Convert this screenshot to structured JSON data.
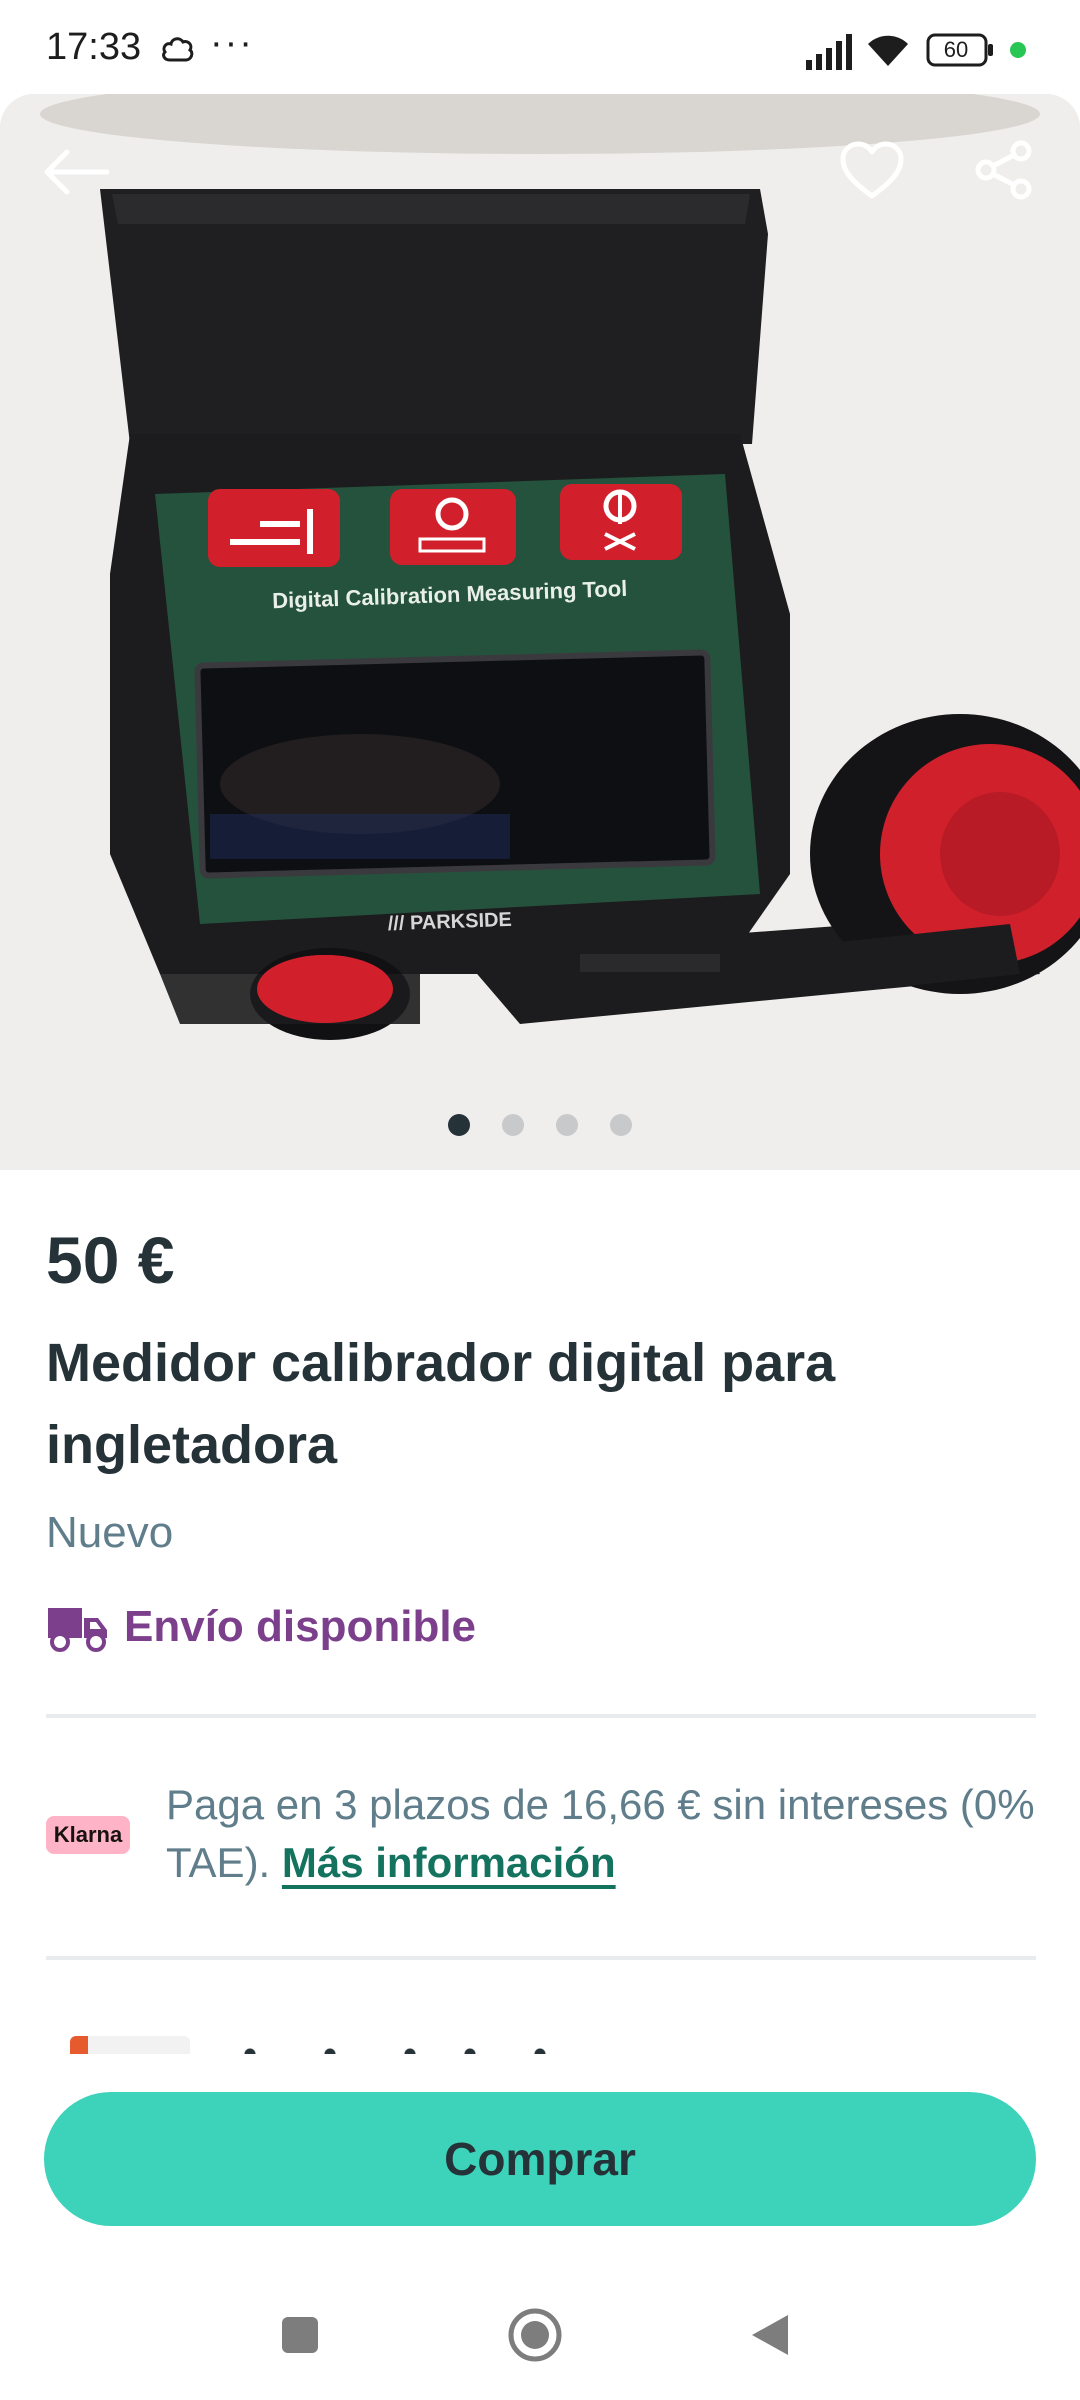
{
  "status_bar": {
    "time": "17:33",
    "more": "···",
    "battery": "60"
  },
  "hero": {
    "product_label": "Digital Calibration Measuring Tool",
    "brand_label": "/// PARKSIDE",
    "image_count": 4,
    "active_image": 1
  },
  "listing": {
    "price": "50 €",
    "title": "Medidor calibrador digital para ingletadora",
    "condition": "Nuevo",
    "shipping": "Envío disponible"
  },
  "klarna": {
    "badge": "Klarna",
    "text": "Paga en 3 plazos de 16,66 € sin intereses (0% TAE). ",
    "link": "Más información"
  },
  "actions": {
    "buy": "Comprar"
  },
  "colors": {
    "primary": "#3dd2ba",
    "shipping": "#7b3f8c",
    "link": "#13735f",
    "text": "#253238"
  }
}
